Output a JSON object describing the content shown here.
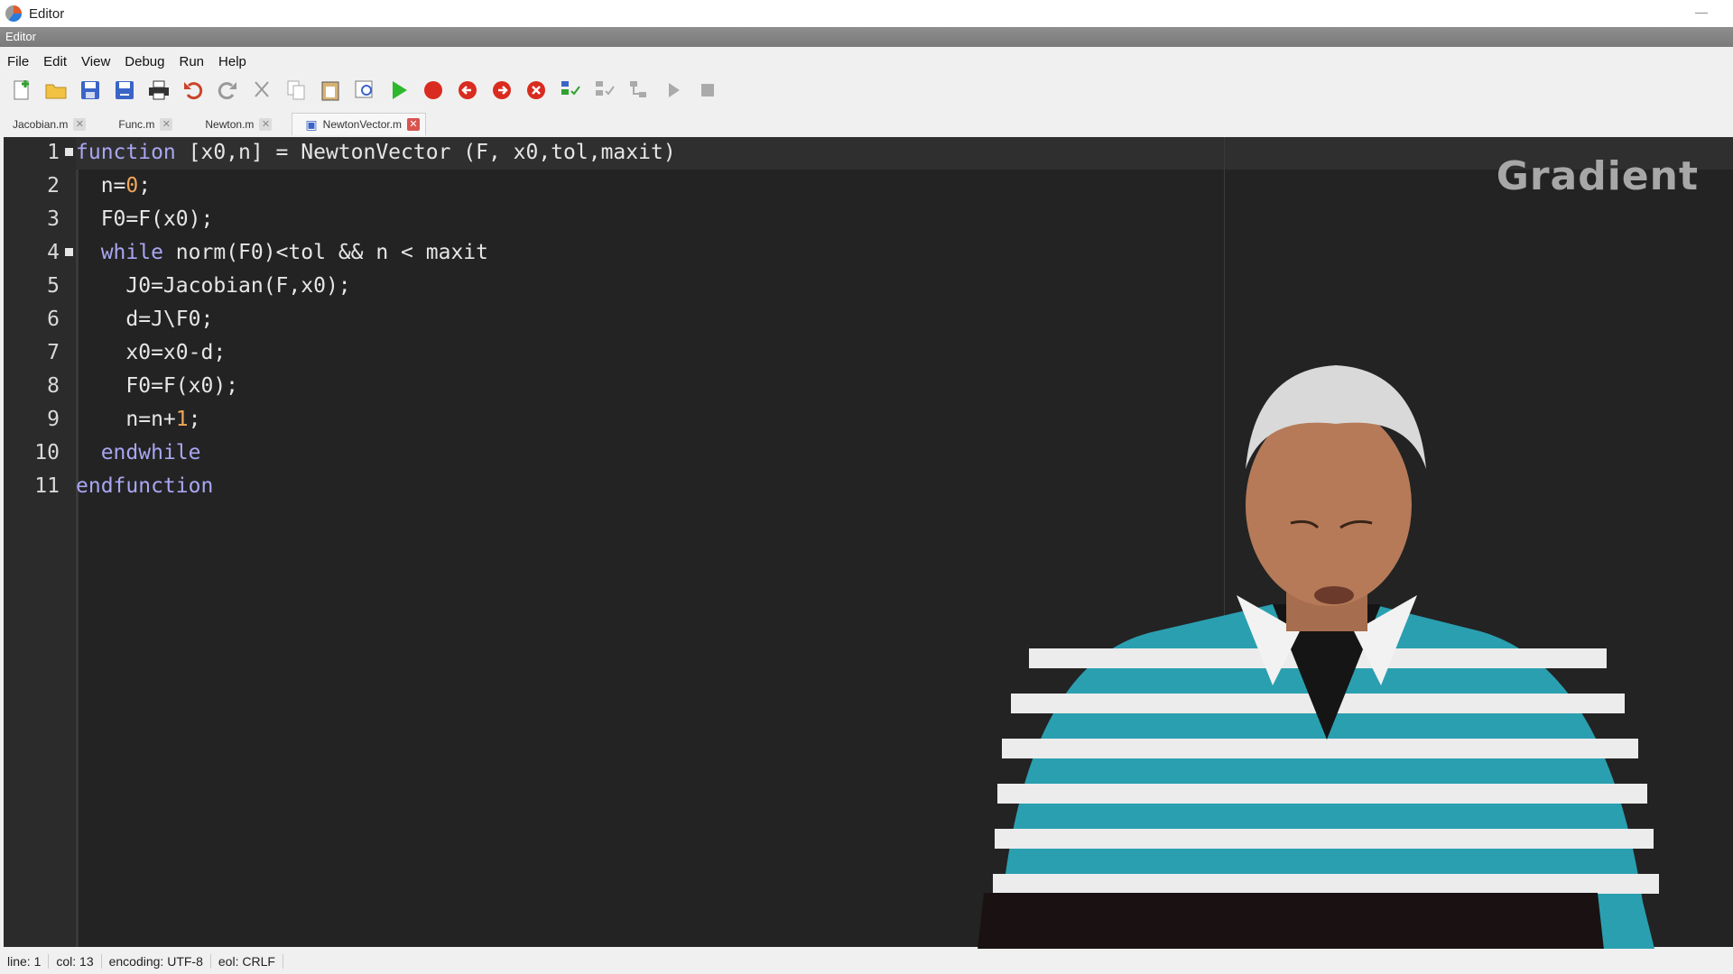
{
  "window": {
    "title": "Editor"
  },
  "dock": {
    "label": "Editor"
  },
  "menu": {
    "items": [
      "File",
      "Edit",
      "View",
      "Debug",
      "Run",
      "Help"
    ]
  },
  "toolbar": {
    "icons": [
      "new-file-icon",
      "open-file-icon",
      "save-icon",
      "save-as-icon",
      "print-icon",
      "undo-icon",
      "redo-icon",
      "cut-icon",
      "copy-icon",
      "paste-icon",
      "find-replace-icon",
      "run-icon",
      "breakpoint-icon",
      "previous-breakpoint-icon",
      "next-breakpoint-icon",
      "remove-breakpoints-icon",
      "step-icon",
      "step-in-icon",
      "step-out-icon",
      "continue-icon",
      "stop-icon"
    ]
  },
  "tabs": [
    {
      "label": "Jacobian.m",
      "active": false
    },
    {
      "label": "Func.m",
      "active": false
    },
    {
      "label": "Newton.m",
      "active": false
    },
    {
      "label": "NewtonVector.m",
      "active": true
    }
  ],
  "code": {
    "lines": [
      {
        "n": "1",
        "fold": true,
        "indent": "",
        "parts": [
          {
            "t": "function",
            "k": "kw"
          },
          {
            "t": " [x0,n] = NewtonVector (F, x0,tol,maxit)",
            "k": ""
          }
        ]
      },
      {
        "n": "2",
        "fold": false,
        "indent": "  ",
        "parts": [
          {
            "t": "n=",
            "k": ""
          },
          {
            "t": "0",
            "k": "num"
          },
          {
            "t": ";",
            "k": ""
          }
        ]
      },
      {
        "n": "3",
        "fold": false,
        "indent": "  ",
        "parts": [
          {
            "t": "F0=F(x0);",
            "k": ""
          }
        ]
      },
      {
        "n": "4",
        "fold": true,
        "indent": "  ",
        "parts": [
          {
            "t": "while",
            "k": "kw"
          },
          {
            "t": " norm(F0)<tol && n < maxit",
            "k": ""
          }
        ]
      },
      {
        "n": "5",
        "fold": false,
        "indent": "    ",
        "parts": [
          {
            "t": "J0=Jacobian(F,x0);",
            "k": ""
          }
        ]
      },
      {
        "n": "6",
        "fold": false,
        "indent": "    ",
        "parts": [
          {
            "t": "d=J\\F0;",
            "k": ""
          }
        ]
      },
      {
        "n": "7",
        "fold": false,
        "indent": "    ",
        "parts": [
          {
            "t": "x0=x0-d;",
            "k": ""
          }
        ]
      },
      {
        "n": "8",
        "fold": false,
        "indent": "    ",
        "parts": [
          {
            "t": "F0=F(x0);",
            "k": ""
          }
        ]
      },
      {
        "n": "9",
        "fold": false,
        "indent": "    ",
        "parts": [
          {
            "t": "n=n+",
            "k": ""
          },
          {
            "t": "1",
            "k": "num"
          },
          {
            "t": ";",
            "k": ""
          }
        ]
      },
      {
        "n": "10",
        "fold": false,
        "indent": "  ",
        "parts": [
          {
            "t": "endwhile",
            "k": "kw"
          }
        ]
      },
      {
        "n": "11",
        "fold": false,
        "indent": "",
        "parts": [
          {
            "t": "endfunction",
            "k": "kw"
          }
        ]
      }
    ]
  },
  "watermark": "Gradient",
  "status": {
    "line": "line: 1",
    "col": "col: 13",
    "encoding": "encoding: UTF-8",
    "eol": "eol: CRLF"
  },
  "colors": {
    "editor_bg": "#232323",
    "keyword": "#a9a6f2",
    "number": "#f2a65a",
    "text": "#e6e6e6"
  }
}
